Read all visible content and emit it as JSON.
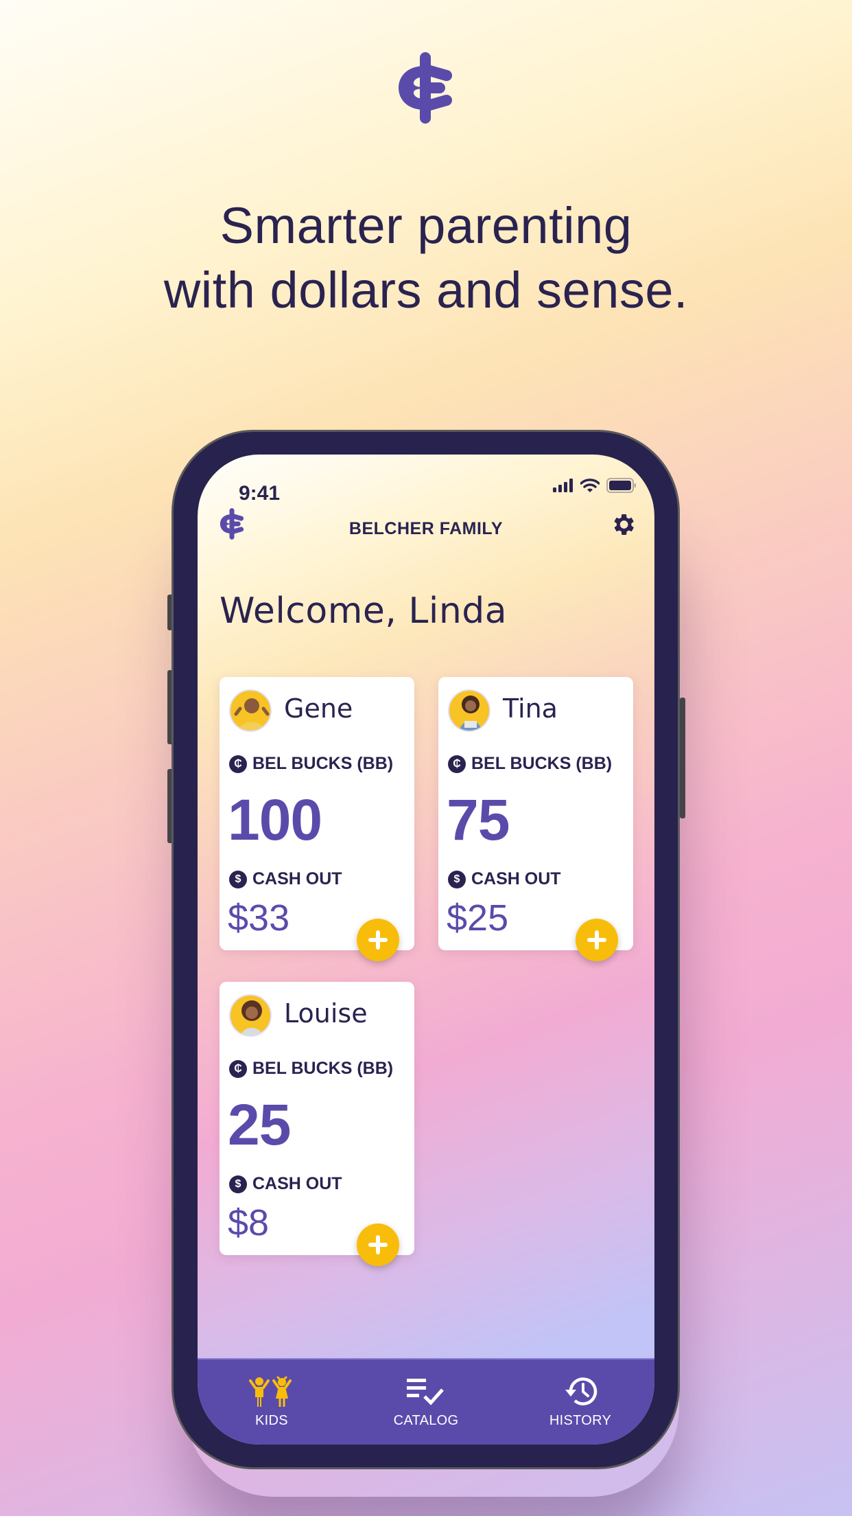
{
  "promo": {
    "logo_icon": "bel-bucks-logo-icon",
    "headline_line1": "Smarter parenting",
    "headline_line2": "with dollars and sense."
  },
  "status_bar": {
    "time": "9:41",
    "icons": [
      "signal-icon",
      "wifi-icon",
      "battery-icon"
    ]
  },
  "header": {
    "logo_icon": "bel-bucks-logo-icon",
    "title": "BELCHER FAMILY",
    "settings_icon": "gear-icon"
  },
  "welcome": "Welcome, Linda",
  "labels": {
    "bucks": "BEL BUCKS (BB)",
    "cash_out": "CASH OUT"
  },
  "kids": [
    {
      "name": "Gene",
      "bel_bucks": "100",
      "cash_out": "$33"
    },
    {
      "name": "Tina",
      "bel_bucks": "75",
      "cash_out": "$25"
    },
    {
      "name": "Louise",
      "bel_bucks": "25",
      "cash_out": "$8"
    }
  ],
  "tabs": [
    {
      "label": "KIDS",
      "icon": "kids-icon",
      "active": true
    },
    {
      "label": "CATALOG",
      "icon": "catalog-checklist-icon",
      "active": false
    },
    {
      "label": "HISTORY",
      "icon": "history-clock-icon",
      "active": false
    }
  ],
  "colors": {
    "brand_purple": "#5a4bab",
    "navy": "#2a2350",
    "accent_yellow": "#f8bd0b"
  }
}
